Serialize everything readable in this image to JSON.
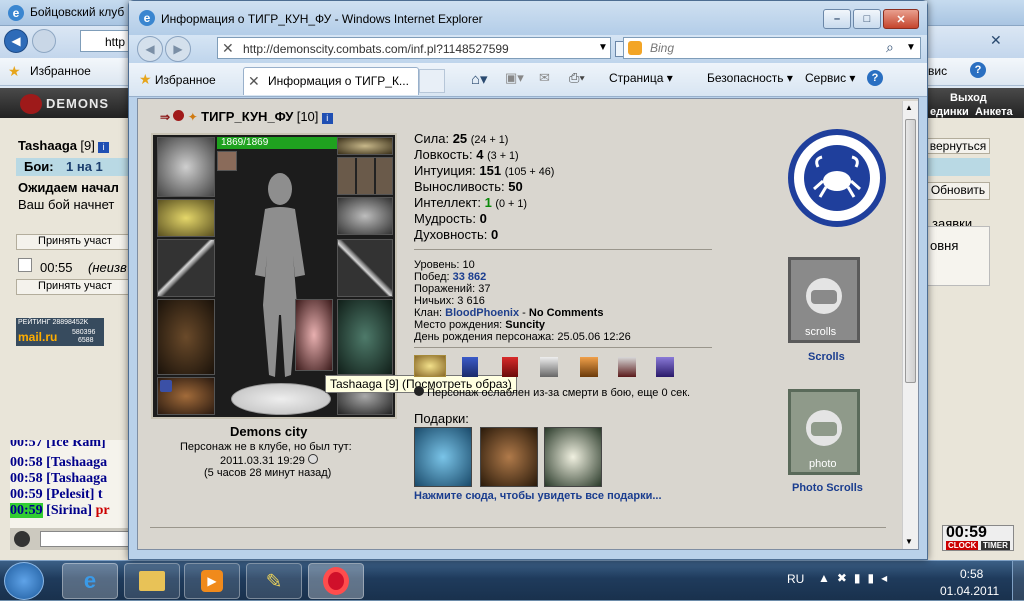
{
  "background_window": {
    "title": "Бойцовский клуб",
    "address_partial": "http",
    "favorites_label": "Избранное",
    "right_tab_fragment": "вис",
    "header_logo": "DEMONS",
    "header_right": "Выход",
    "header_links": [
      "единки",
      "Анкета"
    ],
    "left": {
      "player_name": "Tashaaga",
      "player_level": "[9]",
      "battles_label": "Бои:",
      "battles_tab": "1 на 1",
      "waiting_text": "Ожидаем начал",
      "bout_text": "Ваш бой начнет",
      "accept_button_1": "Принять участ",
      "timer_value": "00:55",
      "timer_note": "(неизв",
      "accept_button_2": "Принять участ",
      "rating_label": "РЕЙТИНГ 28898452K",
      "mailru_label": "mail.ru",
      "rating_nums": [
        "580396",
        "6588"
      ]
    },
    "right": {
      "return_button": "вернуться",
      "refresh_button": "Обновить",
      "requests_label": "заявки",
      "level_label": "овня"
    },
    "chat": [
      {
        "time": "00:57",
        "name": "[Ice Ram]"
      },
      {
        "time": "00:58",
        "name": "[Tashaaga"
      },
      {
        "time": "00:58",
        "name": "[Tashaaga"
      },
      {
        "time": "00:59",
        "name": "[Pelesit]",
        "extra": "t"
      },
      {
        "time": "00:59",
        "name": "[Sirina]",
        "extra": "pr"
      }
    ],
    "clock_widget": {
      "time": "00:59",
      "clock_label": "CLOCK",
      "timer_label": "TIMER"
    }
  },
  "ie": {
    "title": "Информация о ТИГР_КУН_ФУ - Windows Internet Explorer",
    "url": "http://demonscity.combats.com/inf.pl?1148527599",
    "search_placeholder": "Bing",
    "favorites_label": "Избранное",
    "tab_title": "Информация о ТИГР_К...",
    "menu": {
      "page": "Страница",
      "security": "Безопасность",
      "service": "Сервис"
    }
  },
  "character": {
    "name": "ТИГР_КУН_ФУ",
    "level": "[10]",
    "hp": "1869/1869",
    "city": "Demons city",
    "club_note": "Персонаж не в клубе, но был тут:",
    "last_seen": "2011.03.31 19:29",
    "ago": "(5 часов 28 минут назад)",
    "tooltip": "Tashaaga [9] (Посмотреть образ)"
  },
  "stats": [
    {
      "label": "Сила:",
      "value": "25",
      "extra": "(24 + 1)"
    },
    {
      "label": "Ловкость:",
      "value": "4",
      "extra": "(3 + 1)"
    },
    {
      "label": "Интуиция:",
      "value": "151",
      "extra": "(105 + 46)"
    },
    {
      "label": "Выносливость:",
      "value": "50",
      "extra": ""
    },
    {
      "label": "Интеллект:",
      "value": "1",
      "extra": "(0 + 1)"
    },
    {
      "label": "Мудрость:",
      "value": "0",
      "extra": ""
    },
    {
      "label": "Духовность:",
      "value": "0",
      "extra": ""
    }
  ],
  "info": {
    "level": "Уровень: 10",
    "wins_label": "Побед:",
    "wins": "33 862",
    "losses": "Поражений: 37",
    "draws": "Ничьих: 3 616",
    "clan_label": "Клан:",
    "clan": "BloodPhoenix",
    "clan_sep": "-",
    "clan_comment": "No Comments",
    "birthplace_label": "Место рождения:",
    "birthplace": "Suncity",
    "birthday": "День рождения персонажа: 25.05.06 12:26",
    "weakened": "Персонаж ослаблен из-за смерти в бою, еще 0 сек."
  },
  "gifts": {
    "label": "Подарки:",
    "link": "Нажмите сюда, чтобы увидеть все подарки..."
  },
  "banners": {
    "scrolls_caption": "Scrolls",
    "scrolls_text": "scrolls",
    "photo_caption": "Photo Scrolls",
    "photo_text": "photo"
  },
  "taskbar": {
    "lang": "RU",
    "time": "0:58",
    "date": "01.04.2011"
  },
  "colors": {
    "clan": "#1f3f8c",
    "green": "#0a8a0a",
    "hp": "#1fa21f",
    "link": "#1a3d8f"
  }
}
